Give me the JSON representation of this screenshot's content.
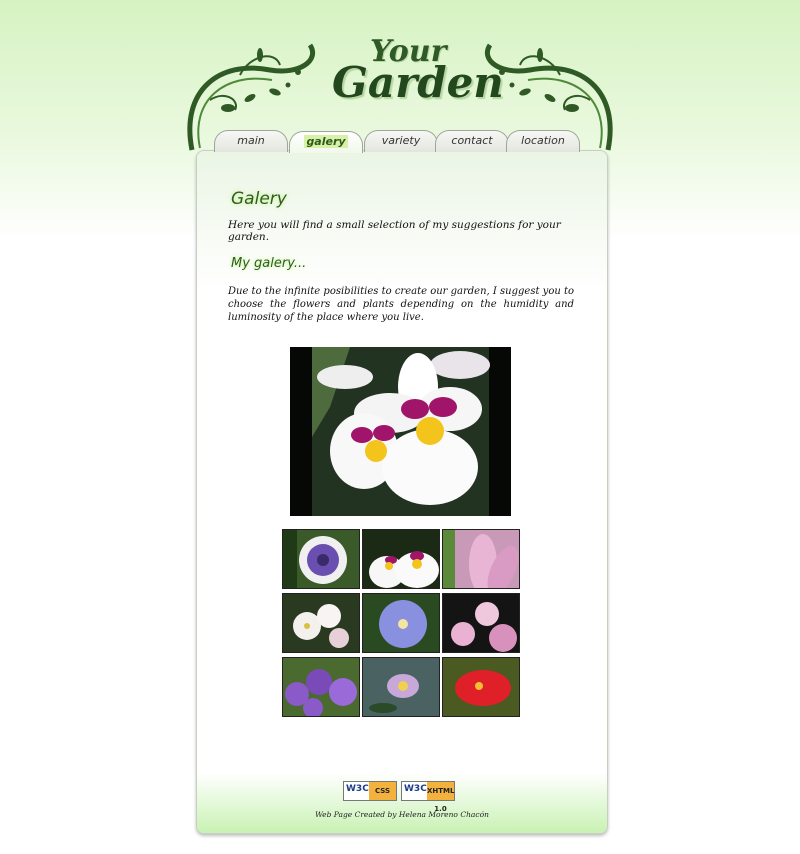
{
  "logo": {
    "line1": "Your",
    "line2": "Garden"
  },
  "nav": {
    "tabs": [
      {
        "label": "main"
      },
      {
        "label": "galery",
        "active": true
      },
      {
        "label": "variety"
      },
      {
        "label": "contact"
      },
      {
        "label": "location"
      }
    ]
  },
  "content": {
    "title": "Galery",
    "intro": "Here you will find a small selection of my suggestions for your garden.",
    "subtitle": "My galery...",
    "description": "Due to the infinite posibilities to create our garden, I suggest you to choose the flowers and plants depending on the humidity and luminosity of the place where you live."
  },
  "gallery": {
    "main_image": "white-purple-orchid",
    "thumbnails": [
      "passion-flower",
      "white-purple-orchid",
      "pink-lily",
      "white-flowers",
      "blue-violet",
      "pink-plumeria",
      "purple-bell-flowers",
      "waterlily",
      "red-flower"
    ]
  },
  "footer": {
    "badge_css": {
      "prefix": "W3C",
      "label": "CSS"
    },
    "badge_xhtml": {
      "prefix": "W3C",
      "label": "XHTML 1.0"
    },
    "credit": "Web Page Created by Helena Moreno Chacón"
  },
  "colors": {
    "accent_green": "#2d5e1e",
    "badge_orange": "#f2b23d"
  }
}
